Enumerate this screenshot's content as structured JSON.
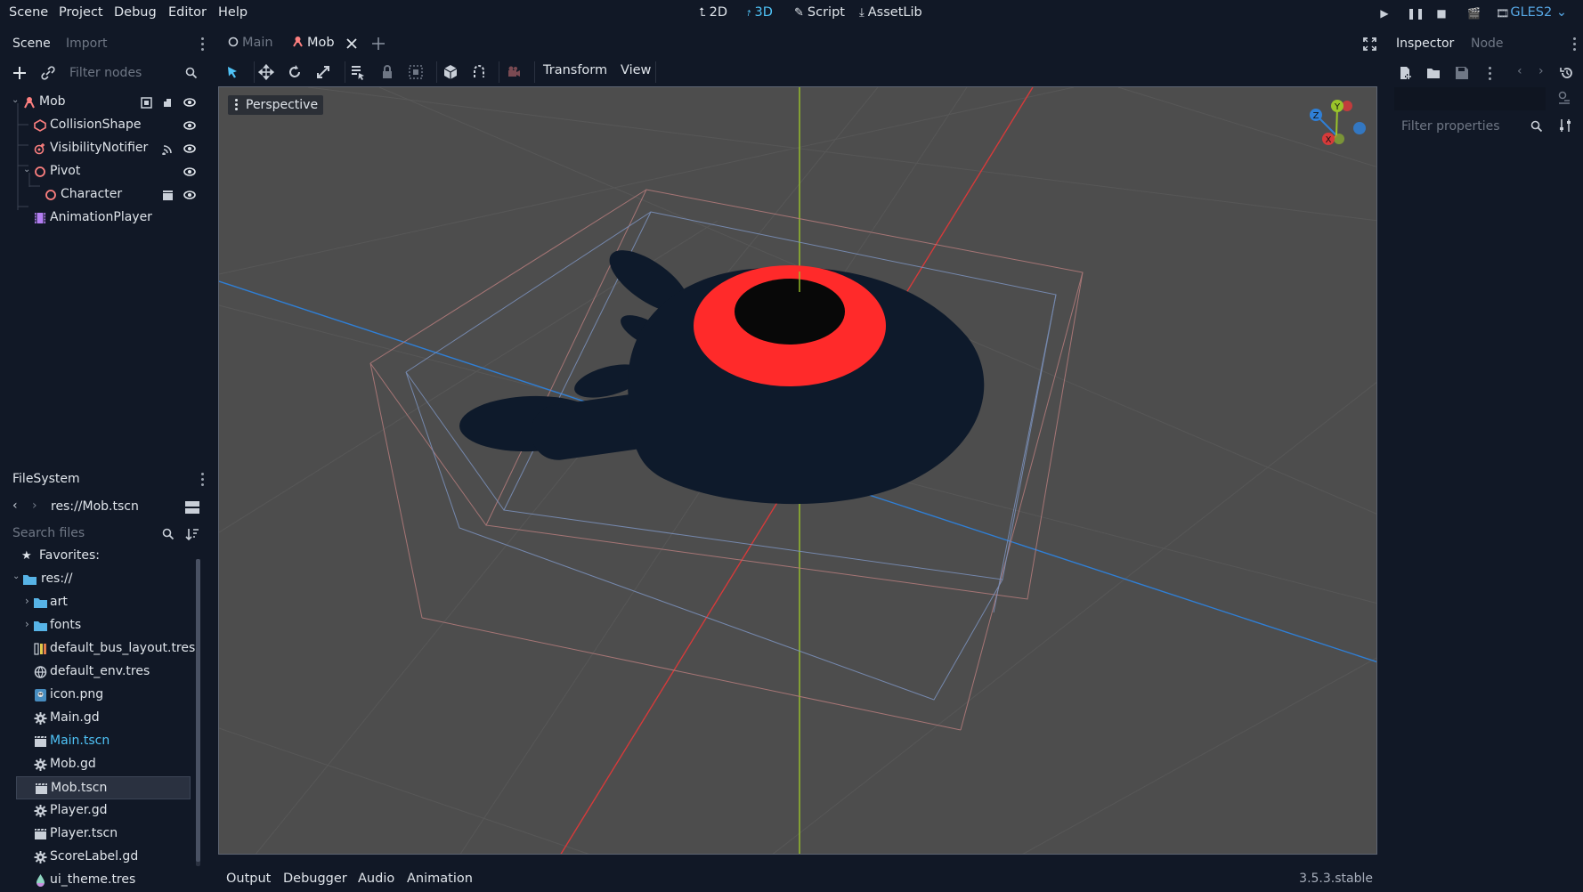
{
  "menubar": {
    "menus": [
      "Scene",
      "Project",
      "Debug",
      "Editor",
      "Help"
    ],
    "workspaces": [
      {
        "label": "2D",
        "icon": "2d-icon",
        "active": false
      },
      {
        "label": "3D",
        "icon": "3d-icon",
        "active": true
      },
      {
        "label": "Script",
        "icon": "script-icon",
        "active": false
      },
      {
        "label": "AssetLib",
        "icon": "assetlib-icon",
        "active": false
      }
    ],
    "renderer": "GLES2",
    "run_controls": [
      "play-icon",
      "pause-icon",
      "stop-icon",
      "play-scene-icon",
      "play-custom-scene-icon"
    ]
  },
  "scene_dock": {
    "tabs": {
      "scene": "Scene",
      "import": "Import"
    },
    "filter_placeholder": "Filter nodes",
    "tree": [
      {
        "name": "Mob",
        "icon": "kinematic-body-icon",
        "depth": 0,
        "expanded": true
      },
      {
        "name": "CollisionShape",
        "icon": "collision-shape-icon",
        "depth": 1
      },
      {
        "name": "VisibilityNotifier",
        "icon": "visibility-notifier-icon",
        "depth": 1
      },
      {
        "name": "Pivot",
        "icon": "spatial-icon",
        "depth": 1,
        "expanded": true
      },
      {
        "name": "Character",
        "icon": "spatial-icon",
        "depth": 2
      },
      {
        "name": "AnimationPlayer",
        "icon": "animation-player-icon",
        "depth": 1
      }
    ]
  },
  "filesystem_dock": {
    "title": "FileSystem",
    "path": "res://Mob.tscn",
    "search_placeholder": "Search files",
    "favorites": "Favorites:",
    "root": "res://",
    "items": [
      {
        "name": "art",
        "icon": "folder-icon",
        "type": "folder"
      },
      {
        "name": "fonts",
        "icon": "folder-icon",
        "type": "folder"
      },
      {
        "name": "default_bus_layout.tres",
        "icon": "audio-bus-layout-icon"
      },
      {
        "name": "default_env.tres",
        "icon": "environment-icon"
      },
      {
        "name": "icon.png",
        "icon": "image-icon"
      },
      {
        "name": "Main.gd",
        "icon": "gear-icon"
      },
      {
        "name": "Main.tscn",
        "icon": "scene-icon",
        "highlight": true
      },
      {
        "name": "Mob.gd",
        "icon": "gear-icon"
      },
      {
        "name": "Mob.tscn",
        "icon": "scene-icon",
        "selected": true
      },
      {
        "name": "Player.gd",
        "icon": "gear-icon"
      },
      {
        "name": "Player.tscn",
        "icon": "scene-icon"
      },
      {
        "name": "ScoreLabel.gd",
        "icon": "gear-icon"
      },
      {
        "name": "ui_theme.tres",
        "icon": "theme-icon"
      }
    ]
  },
  "editor": {
    "scene_tabs": [
      {
        "label": "Main",
        "active": false
      },
      {
        "label": "Mob",
        "active": true
      }
    ],
    "toolbar_menus": {
      "transform": "Transform",
      "view": "View"
    },
    "viewport_label": "Perspective",
    "gizmo_axes": {
      "x": "X",
      "y": "Y",
      "z": "Z"
    },
    "colors": {
      "mob_body": "#0e1a2b",
      "mob_eye_ring": "#ff2a2a",
      "mob_pupil": "#080808",
      "axis_x": "#d63a3a",
      "axis_y": "#9ac42a",
      "axis_z": "#2f7fd6"
    }
  },
  "bottom_panel": {
    "tabs": [
      "Output",
      "Debugger",
      "Audio",
      "Animation"
    ],
    "version": "3.5.3.stable"
  },
  "inspector_dock": {
    "tabs": {
      "inspector": "Inspector",
      "node": "Node"
    },
    "filter_placeholder": "Filter properties"
  }
}
